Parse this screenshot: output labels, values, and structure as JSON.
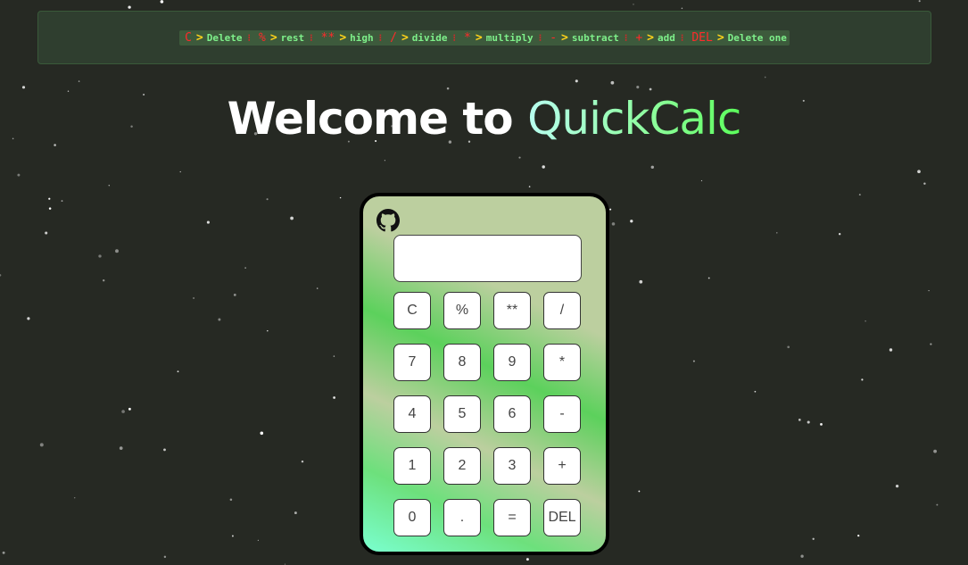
{
  "legend": [
    {
      "key": "C",
      "desc": "Delete"
    },
    {
      "key": "%",
      "desc": "rest"
    },
    {
      "key": "**",
      "desc": "high"
    },
    {
      "key": "/",
      "desc": "divide"
    },
    {
      "key": "*",
      "desc": "multiply"
    },
    {
      "key": "-",
      "desc": "subtract"
    },
    {
      "key": "+",
      "desc": "add"
    },
    {
      "key": "DEL",
      "desc": "Delete one"
    }
  ],
  "legend_arrow": ">",
  "legend_separator": "⁝",
  "title": {
    "prefix": "Welcome to",
    "brand": "QuickCalc"
  },
  "github_icon": "github-icon",
  "display": {
    "value": ""
  },
  "buttons": [
    [
      "C",
      "%",
      "**",
      "/"
    ],
    [
      "7",
      "8",
      "9",
      "*"
    ],
    [
      "4",
      "5",
      "6",
      "-"
    ],
    [
      "1",
      "2",
      "3",
      "+"
    ],
    [
      "0",
      ".",
      "=",
      "DEL"
    ]
  ],
  "colors": {
    "background": "#262923",
    "legend_key": "#ff2a2a",
    "legend_arrow": "#ffd21a",
    "legend_desc": "#7ef08a"
  }
}
